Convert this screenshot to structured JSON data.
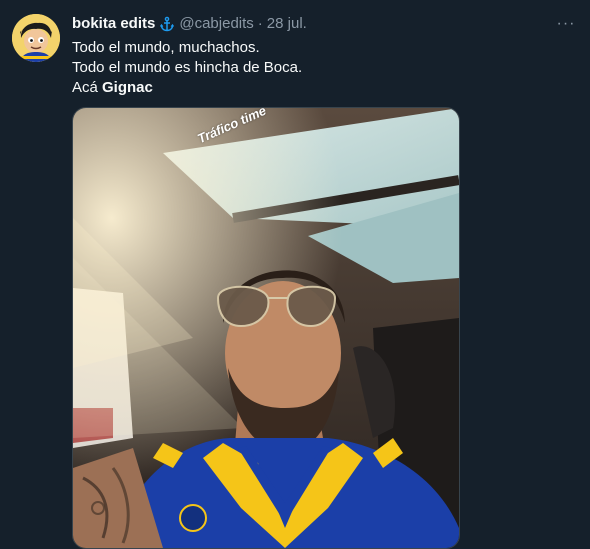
{
  "tweet": {
    "author_name": "bokita edits",
    "author_badge_icon": "anchor-icon",
    "handle": "@cabjedits",
    "separator": "·",
    "date": "28 jul.",
    "more_icon": "more-icon",
    "more_label": "···",
    "text_lines": [
      "Todo el mundo, muchachos.",
      "Todo el mundo es hincha de Boca.",
      "Acá "
    ],
    "text_strong": "Gignac",
    "media": {
      "sticker_text": "Tráfico time",
      "description_icon": "photo-icon"
    }
  },
  "colors": {
    "background": "#15202b",
    "text_primary": "#f7f9f9",
    "text_secondary": "#8b98a5",
    "accent": "#1d9bf0",
    "boca_blue": "#1b3fa8",
    "boca_yellow": "#f5c518"
  }
}
